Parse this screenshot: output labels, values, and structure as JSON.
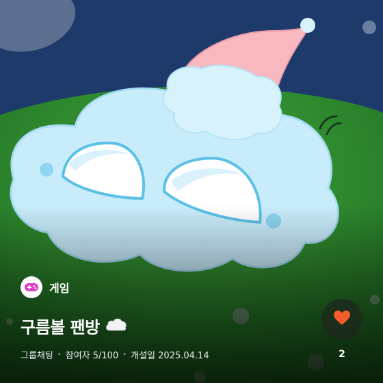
{
  "category": {
    "label": "게임",
    "icon": "game-controller-icon",
    "icon_color": "#e040c8"
  },
  "room": {
    "title": "구름볼 팬방",
    "title_emoji": "cloud-icon",
    "type": "그룹채팅",
    "participants": "참여자 5/100",
    "opened": "개설일 2025.04.14"
  },
  "like": {
    "count": "2",
    "icon": "heart-icon",
    "color": "#f25b2a"
  },
  "colors": {
    "sky": "#1d3a6b",
    "grass": "#2f8f2e",
    "cloud": "#c9ecfb"
  }
}
